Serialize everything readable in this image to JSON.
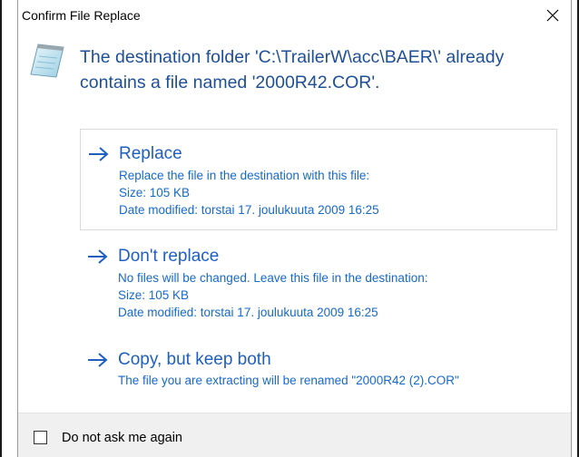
{
  "window": {
    "title": "Confirm File Replace",
    "close_icon": "close-icon"
  },
  "header": {
    "icon": "notepad-document-icon",
    "message": "The destination folder 'C:\\TrailerW\\acc\\BAER\\' already contains a file named '2000R42.COR'."
  },
  "options": [
    {
      "icon": "arrow-right-icon",
      "title": "Replace",
      "lines": [
        "Replace the file in the destination with this file:",
        "Size: 105 KB",
        "Date modified: torstai 17. joulukuuta 2009 16:25"
      ]
    },
    {
      "icon": "arrow-right-icon",
      "title": "Don't replace",
      "lines": [
        "No files will be changed. Leave this file in the destination:",
        "Size: 105 KB",
        "Date modified: torstai 17. joulukuuta 2009 16:25"
      ]
    },
    {
      "icon": "arrow-right-icon",
      "title": "Copy, but keep both",
      "lines": [
        "The file you are extracting will be renamed \"2000R42 (2).COR\""
      ]
    }
  ],
  "footer": {
    "checkbox_label": "Do not ask me again",
    "checked": false
  },
  "colors": {
    "header_text": "#1e4f97",
    "option_title": "#1e5fc0",
    "option_detail": "#1769c9",
    "footer_bg": "#f0f0f0"
  }
}
